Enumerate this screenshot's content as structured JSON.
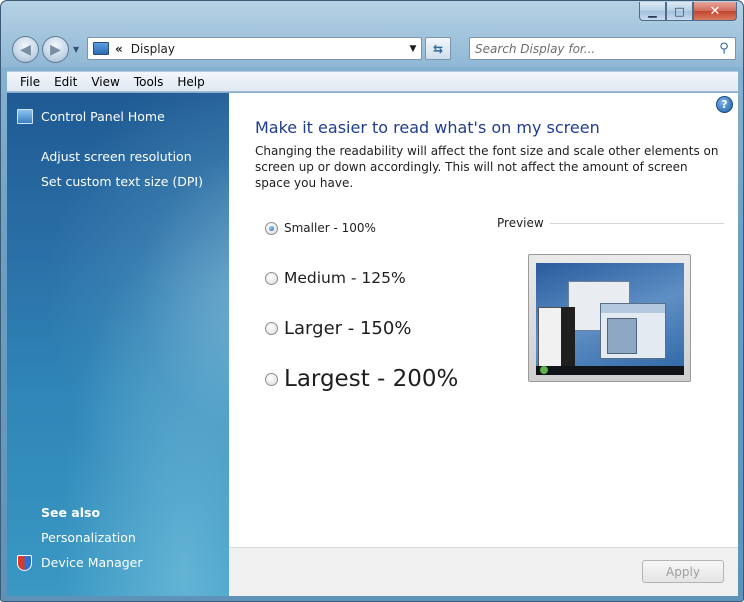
{
  "window": {
    "caption_buttons": {
      "minimize": "▁",
      "maximize": "□",
      "close": "✕"
    }
  },
  "nav": {
    "back_glyph": "◀",
    "forward_glyph": "▶",
    "dropdown_glyph": "▼",
    "refresh_glyph": "⇆"
  },
  "address": {
    "separator": "«",
    "location": "Display",
    "dropdown_glyph": "▼"
  },
  "search": {
    "placeholder": "Search Display for...",
    "icon_glyph": "⚲"
  },
  "menu": {
    "items": [
      "File",
      "Edit",
      "View",
      "Tools",
      "Help"
    ]
  },
  "sidebar": {
    "home_label": "Control Panel Home",
    "tasks": [
      "Adjust screen resolution",
      "Set custom text size (DPI)"
    ],
    "see_also_heading": "See also",
    "see_also": [
      "Personalization",
      "Device Manager"
    ]
  },
  "main": {
    "help_glyph": "?",
    "title": "Make it easier to read what's on my screen",
    "description": "Changing the readability will affect the font size and scale other elements on screen up or down accordingly. This will not affect the amount of screen space you have.",
    "options": [
      {
        "label": "Smaller - 100%",
        "selected": true
      },
      {
        "label": "Medium - 125%",
        "selected": false
      },
      {
        "label": "Larger - 150%",
        "selected": false
      },
      {
        "label": "Largest - 200%",
        "selected": false
      }
    ],
    "preview_label": "Preview"
  },
  "footer": {
    "apply_label": "Apply"
  }
}
